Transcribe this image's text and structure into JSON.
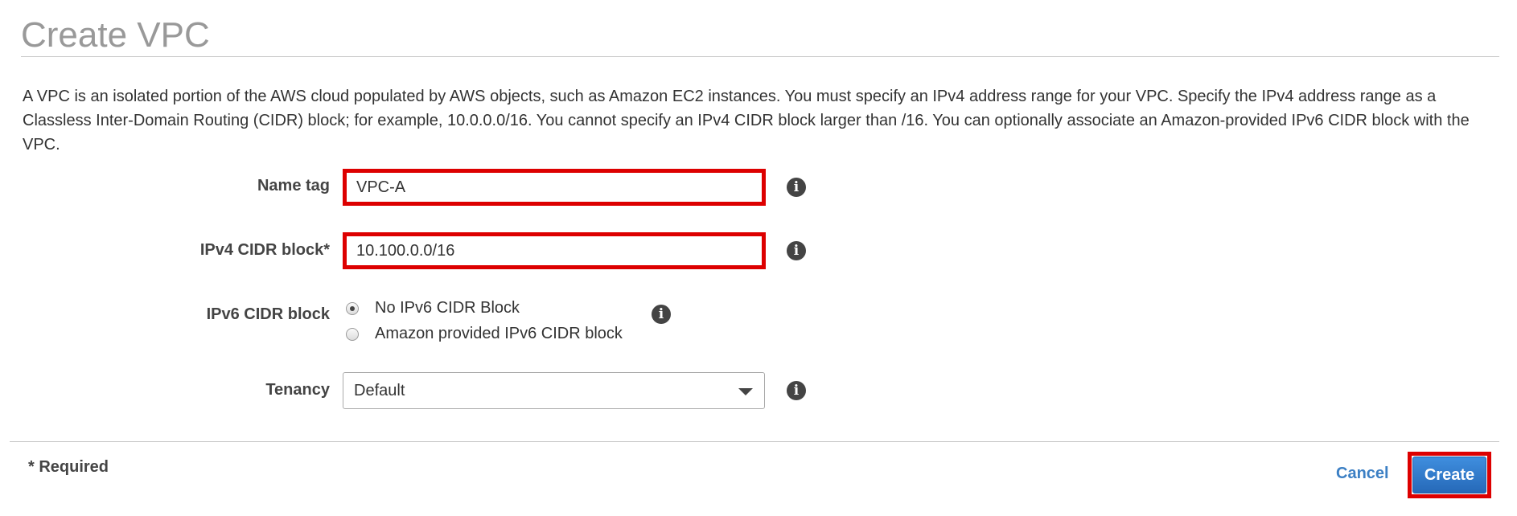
{
  "page": {
    "title": "Create VPC",
    "description": "A VPC is an isolated portion of the AWS cloud populated by AWS objects, such as Amazon EC2 instances. You must specify an IPv4 address range for your VPC. Specify the IPv4 address range as a Classless Inter-Domain Routing (CIDR) block; for example, 10.0.0.0/16. You cannot specify an IPv4 CIDR block larger than /16. You can optionally associate an Amazon-provided IPv6 CIDR block with the VPC."
  },
  "form": {
    "name_tag": {
      "label": "Name tag",
      "value": "VPC-A",
      "icon": "info-icon"
    },
    "ipv4_cidr": {
      "label": "IPv4 CIDR block*",
      "value": "10.100.0.0/16",
      "icon": "info-icon"
    },
    "ipv6_cidr": {
      "label": "IPv6 CIDR block",
      "options": [
        {
          "label": "No IPv6 CIDR Block",
          "selected": true
        },
        {
          "label": "Amazon provided IPv6 CIDR block",
          "selected": false
        }
      ],
      "icon": "info-icon"
    },
    "tenancy": {
      "label": "Tenancy",
      "value": "Default",
      "icon": "info-icon"
    }
  },
  "footer": {
    "required_note": "* Required",
    "cancel_label": "Cancel",
    "create_label": "Create"
  },
  "colors": {
    "highlight": "#dd0000",
    "primary_button": "#2669b8",
    "link": "#3b7fc4",
    "title": "#999999"
  }
}
